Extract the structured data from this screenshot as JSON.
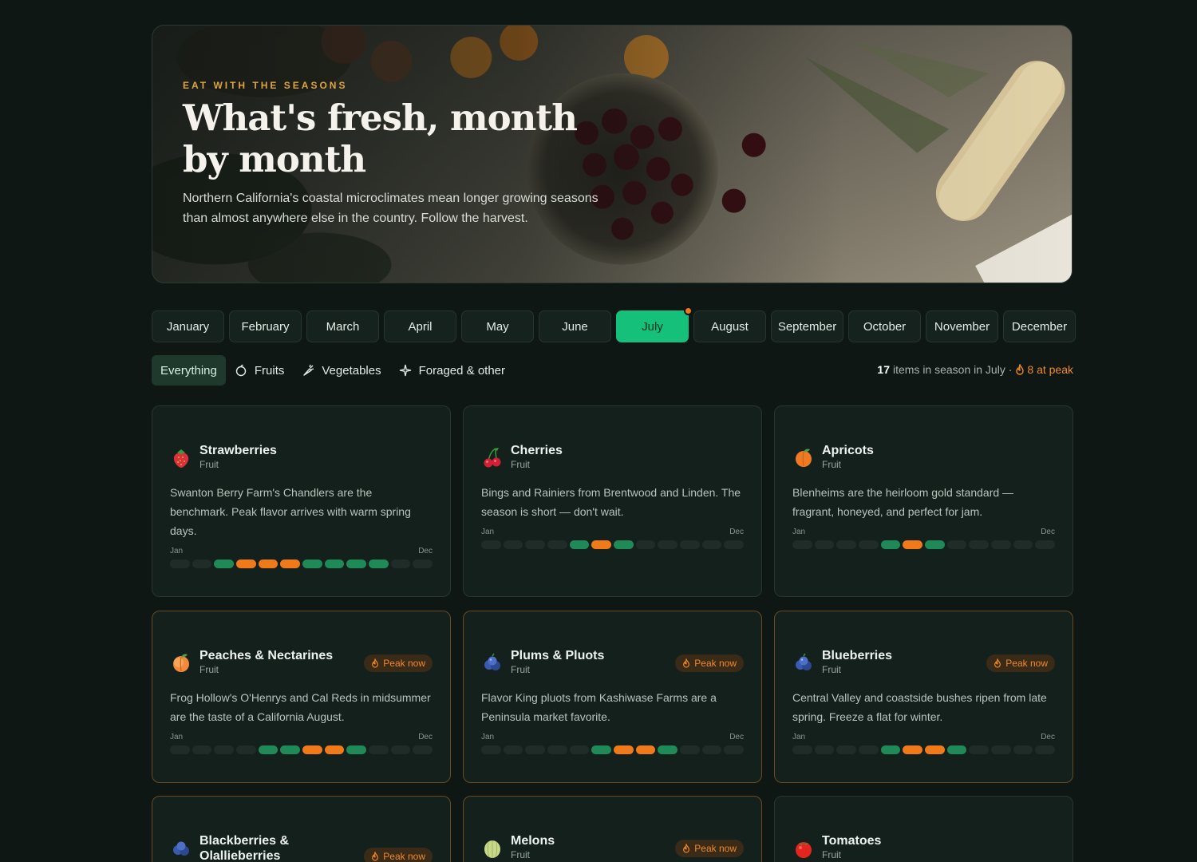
{
  "hero": {
    "eyebrow": "EAT WITH THE SEASONS",
    "title": "What's fresh, month by month",
    "subtitle": "Northern California's coastal microclimates mean longer growing seasons than almost anywhere else in the country. Follow the harvest."
  },
  "months": [
    "January",
    "February",
    "March",
    "April",
    "May",
    "June",
    "July",
    "August",
    "September",
    "October",
    "November",
    "December"
  ],
  "selected_month": "July",
  "filters": {
    "items": [
      {
        "label": "Everything",
        "icon": "none",
        "active": true
      },
      {
        "label": "Fruits",
        "icon": "apple-icon",
        "active": false
      },
      {
        "label": "Vegetables",
        "icon": "carrot-icon",
        "active": false
      },
      {
        "label": "Foraged & other",
        "icon": "sparkle-icon",
        "active": false
      }
    ]
  },
  "summary": {
    "count": "17",
    "text": "items in season in July ·",
    "peak": "8 at peak"
  },
  "season_labels": {
    "start": "Jan",
    "end": "Dec"
  },
  "peak_label": "Peak now",
  "colors": {
    "accent": "#14c07a",
    "peak": "#f07a1a",
    "in_season": "#1f8a57"
  },
  "cards": [
    {
      "name": "Strawberries",
      "type": "Fruit",
      "icon": "strawberry-icon",
      "peak_now": false,
      "desc": "Swanton Berry Farm's Chandlers are the benchmark. Peak flavor arrives with warm spring days.",
      "season": [
        0,
        0,
        1,
        2,
        2,
        2,
        1,
        1,
        1,
        1,
        0,
        0
      ]
    },
    {
      "name": "Cherries",
      "type": "Fruit",
      "icon": "cherries-icon",
      "peak_now": false,
      "desc": "Bings and Rainiers from Brentwood and Linden. The season is short — don't wait.",
      "season": [
        0,
        0,
        0,
        0,
        1,
        2,
        1,
        0,
        0,
        0,
        0,
        0
      ]
    },
    {
      "name": "Apricots",
      "type": "Fruit",
      "icon": "apricot-icon",
      "peak_now": false,
      "desc": "Blenheims are the heirloom gold standard — fragrant, honeyed, and perfect for jam.",
      "season": [
        0,
        0,
        0,
        0,
        1,
        2,
        1,
        0,
        0,
        0,
        0,
        0
      ]
    },
    {
      "name": "Peaches & Nectarines",
      "type": "Fruit",
      "icon": "peach-icon",
      "peak_now": true,
      "desc": "Frog Hollow's O'Henrys and Cal Reds in midsummer are the taste of a California August.",
      "season": [
        0,
        0,
        0,
        0,
        1,
        1,
        2,
        2,
        1,
        0,
        0,
        0
      ]
    },
    {
      "name": "Plums & Pluots",
      "type": "Fruit",
      "icon": "plum-icon",
      "peak_now": true,
      "desc": "Flavor King pluots from Kashiwase Farms are a Peninsula market favorite.",
      "season": [
        0,
        0,
        0,
        0,
        0,
        1,
        2,
        2,
        1,
        0,
        0,
        0
      ]
    },
    {
      "name": "Blueberries",
      "type": "Fruit",
      "icon": "blueberry-icon",
      "peak_now": true,
      "desc": "Central Valley and coastside bushes ripen from late spring. Freeze a flat for winter.",
      "season": [
        0,
        0,
        0,
        0,
        1,
        2,
        2,
        1,
        0,
        0,
        0,
        0
      ]
    },
    {
      "name": "Blackberries & Olallieberries",
      "type": "Fruit",
      "icon": "blackberry-icon",
      "peak_now": true,
      "desc": "",
      "season": []
    },
    {
      "name": "Melons",
      "type": "Fruit",
      "icon": "melon-icon",
      "peak_now": true,
      "desc": "",
      "season": []
    },
    {
      "name": "Tomatoes",
      "type": "Fruit",
      "icon": "tomato-icon",
      "peak_now": false,
      "desc": "",
      "season": []
    }
  ]
}
